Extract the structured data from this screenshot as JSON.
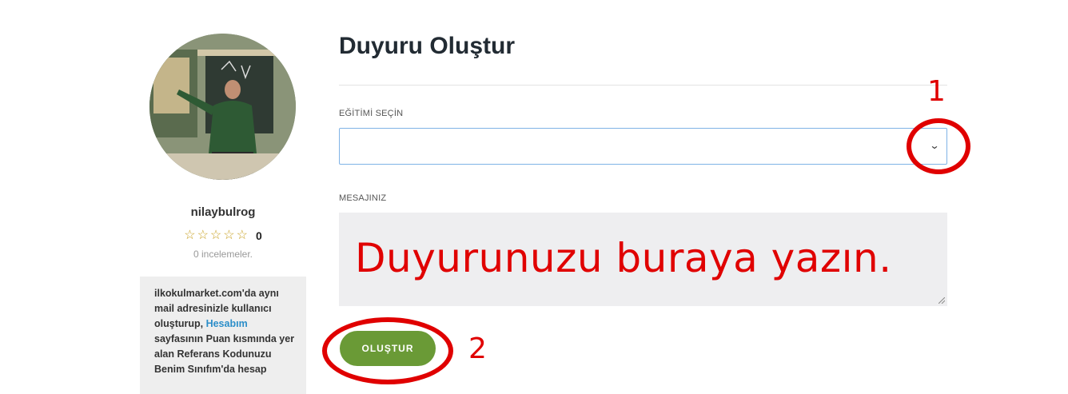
{
  "profile": {
    "username": "nilaybulrog",
    "rating_value": "0",
    "stars": 5,
    "reviews_label": "0 incelemeler.",
    "info_parts": {
      "before": "ilkokulmarket.com'da aynı mail adresinizle kullanıcı oluşturup, ",
      "link": "Hesabım",
      "after": " sayfasının Puan kısmında yer alan Referans Kodunuzu Benim Sınıfım'da hesap"
    }
  },
  "form": {
    "title": "Duyuru Oluştur",
    "select_label": "EĞİTİMİ SEÇİN",
    "select_value": "",
    "message_label": "MESAJINIZ",
    "message_placeholder": "Duyurunuzu buraya yazın.",
    "submit_label": "OLUŞTUR"
  },
  "annotations": {
    "one": "1",
    "two": "2"
  },
  "colors": {
    "accent_green": "#6a9a36",
    "annotation_red": "#e00000",
    "link_blue": "#2b8ec9",
    "star_gold": "#c9a227"
  }
}
